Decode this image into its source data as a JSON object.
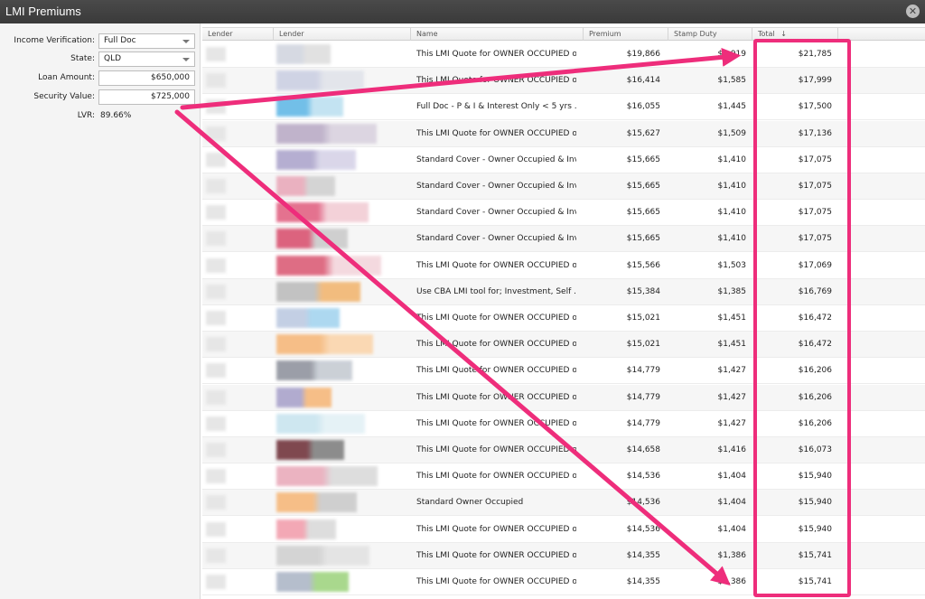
{
  "window": {
    "title": "LMI Premiums",
    "close_icon": "close-icon"
  },
  "form": {
    "income_verification": {
      "label": "Income Verification:",
      "value": "Full Doc"
    },
    "state": {
      "label": "State:",
      "value": "QLD"
    },
    "loan_amount": {
      "label": "Loan Amount:",
      "value": "$650,000"
    },
    "security_value": {
      "label": "Security Value:",
      "value": "$725,000"
    },
    "lvr": {
      "label": "LVR:",
      "value": "89.66%"
    }
  },
  "table": {
    "columns": [
      "Lender",
      "Lender",
      "Name",
      "Premium",
      "Stamp Duty",
      "Total"
    ],
    "sort": {
      "column": "Total",
      "direction": "descending",
      "indicator": "↓"
    },
    "rows": [
      {
        "name": "This LMI Quote for OWNER OCCUPIED o...",
        "premium": "$19,866",
        "stamp_duty": "$1,919",
        "total": "$21,785",
        "c1": "#cfd3de",
        "c2": "#dcdcdc"
      },
      {
        "name": "This LMI Quote for OWNER OCCUPIED o...",
        "premium": "$16,414",
        "stamp_duty": "$1,585",
        "total": "$17,999",
        "c1": "#c9cde2",
        "c2": "#e0e3ea"
      },
      {
        "name": "Full Doc - P & I & Interest Only < 5 yrs ...",
        "premium": "$16,055",
        "stamp_duty": "$1,445",
        "total": "$17,500",
        "c1": "#5ab4e5",
        "c2": "#b9dff0"
      },
      {
        "name": "This LMI Quote for OWNER OCCUPIED o...",
        "premium": "$15,627",
        "stamp_duty": "$1,509",
        "total": "$17,136",
        "c1": "#b7a8c4",
        "c2": "#d8d0de"
      },
      {
        "name": "Standard Cover - Owner Occupied & Inv...",
        "premium": "$15,665",
        "stamp_duty": "$1,410",
        "total": "$17,075",
        "c1": "#a9a1c9",
        "c2": "#d4d0e6"
      },
      {
        "name": "Standard Cover - Owner Occupied & Inv...",
        "premium": "$15,665",
        "stamp_duty": "$1,410",
        "total": "$17,075",
        "c1": "#e8a6b7",
        "c2": "#cfcfcf"
      },
      {
        "name": "Standard Cover - Owner Occupied & Inv...",
        "premium": "$15,665",
        "stamp_duty": "$1,410",
        "total": "$17,075",
        "c1": "#e05a7c",
        "c2": "#f1c9d2"
      },
      {
        "name": "Standard Cover - Owner Occupied & Inv...",
        "premium": "$15,665",
        "stamp_duty": "$1,410",
        "total": "$17,075",
        "c1": "#d84a6a",
        "c2": "#c9c9c9"
      },
      {
        "name": "This LMI Quote for OWNER OCCUPIED o...",
        "premium": "$15,566",
        "stamp_duty": "$1,503",
        "total": "$17,069",
        "c1": "#d9546f",
        "c2": "#f3d3da"
      },
      {
        "name": "Use CBA LMI tool for; Investment, Self ...",
        "premium": "$15,384",
        "stamp_duty": "$1,385",
        "total": "$16,769",
        "c1": "#b9b9b9",
        "c2": "#f2b36a"
      },
      {
        "name": "This LMI Quote for OWNER OCCUPIED o...",
        "premium": "$15,021",
        "stamp_duty": "$1,451",
        "total": "$16,472",
        "c1": "#b9c7e0",
        "c2": "#9fd2ee"
      },
      {
        "name": "This LMI Quote for OWNER OCCUPIED o...",
        "premium": "$15,021",
        "stamp_duty": "$1,451",
        "total": "$16,472",
        "c1": "#f6b574",
        "c2": "#fbd3a8"
      },
      {
        "name": "This LMI Quote for OWNER OCCUPIED o...",
        "premium": "$14,779",
        "stamp_duty": "$1,427",
        "total": "$16,206",
        "c1": "#8a8e99",
        "c2": "#c2c8d0"
      },
      {
        "name": "This LMI Quote for OWNER OCCUPIED o...",
        "premium": "$14,779",
        "stamp_duty": "$1,427",
        "total": "$16,206",
        "c1": "#a59ec9",
        "c2": "#f6b574"
      },
      {
        "name": "This LMI Quote for OWNER OCCUPIED o...",
        "premium": "$14,779",
        "stamp_duty": "$1,427",
        "total": "$16,206",
        "c1": "#c6e3ee",
        "c2": "#e1f0f5"
      },
      {
        "name": "This LMI Quote for OWNER OCCUPIED o...",
        "premium": "$14,658",
        "stamp_duty": "$1,416",
        "total": "$16,073",
        "c1": "#6b2a33",
        "c2": "#7a7a7a"
      },
      {
        "name": "This LMI Quote for OWNER OCCUPIED o...",
        "premium": "$14,536",
        "stamp_duty": "$1,404",
        "total": "$15,940",
        "c1": "#e8a6b7",
        "c2": "#d8d8d8"
      },
      {
        "name": "Standard Owner Occupied",
        "premium": "$14,536",
        "stamp_duty": "$1,404",
        "total": "$15,940",
        "c1": "#f6b574",
        "c2": "#c9c9c9"
      },
      {
        "name": "This LMI Quote for OWNER OCCUPIED o...",
        "premium": "$14,536",
        "stamp_duty": "$1,404",
        "total": "$15,940",
        "c1": "#f19aa9",
        "c2": "#d8d8d8"
      },
      {
        "name": "This LMI Quote for OWNER OCCUPIED o...",
        "premium": "$14,355",
        "stamp_duty": "$1,386",
        "total": "$15,741",
        "c1": "#cfcfcf",
        "c2": "#e2e2e2"
      },
      {
        "name": "This LMI Quote for OWNER OCCUPIED o...",
        "premium": "$14,355",
        "stamp_duty": "$1,386",
        "total": "$15,741",
        "c1": "#a9b3c4",
        "c2": "#9bd27a"
      }
    ]
  },
  "annotation": {
    "color": "#ee2d7b"
  }
}
